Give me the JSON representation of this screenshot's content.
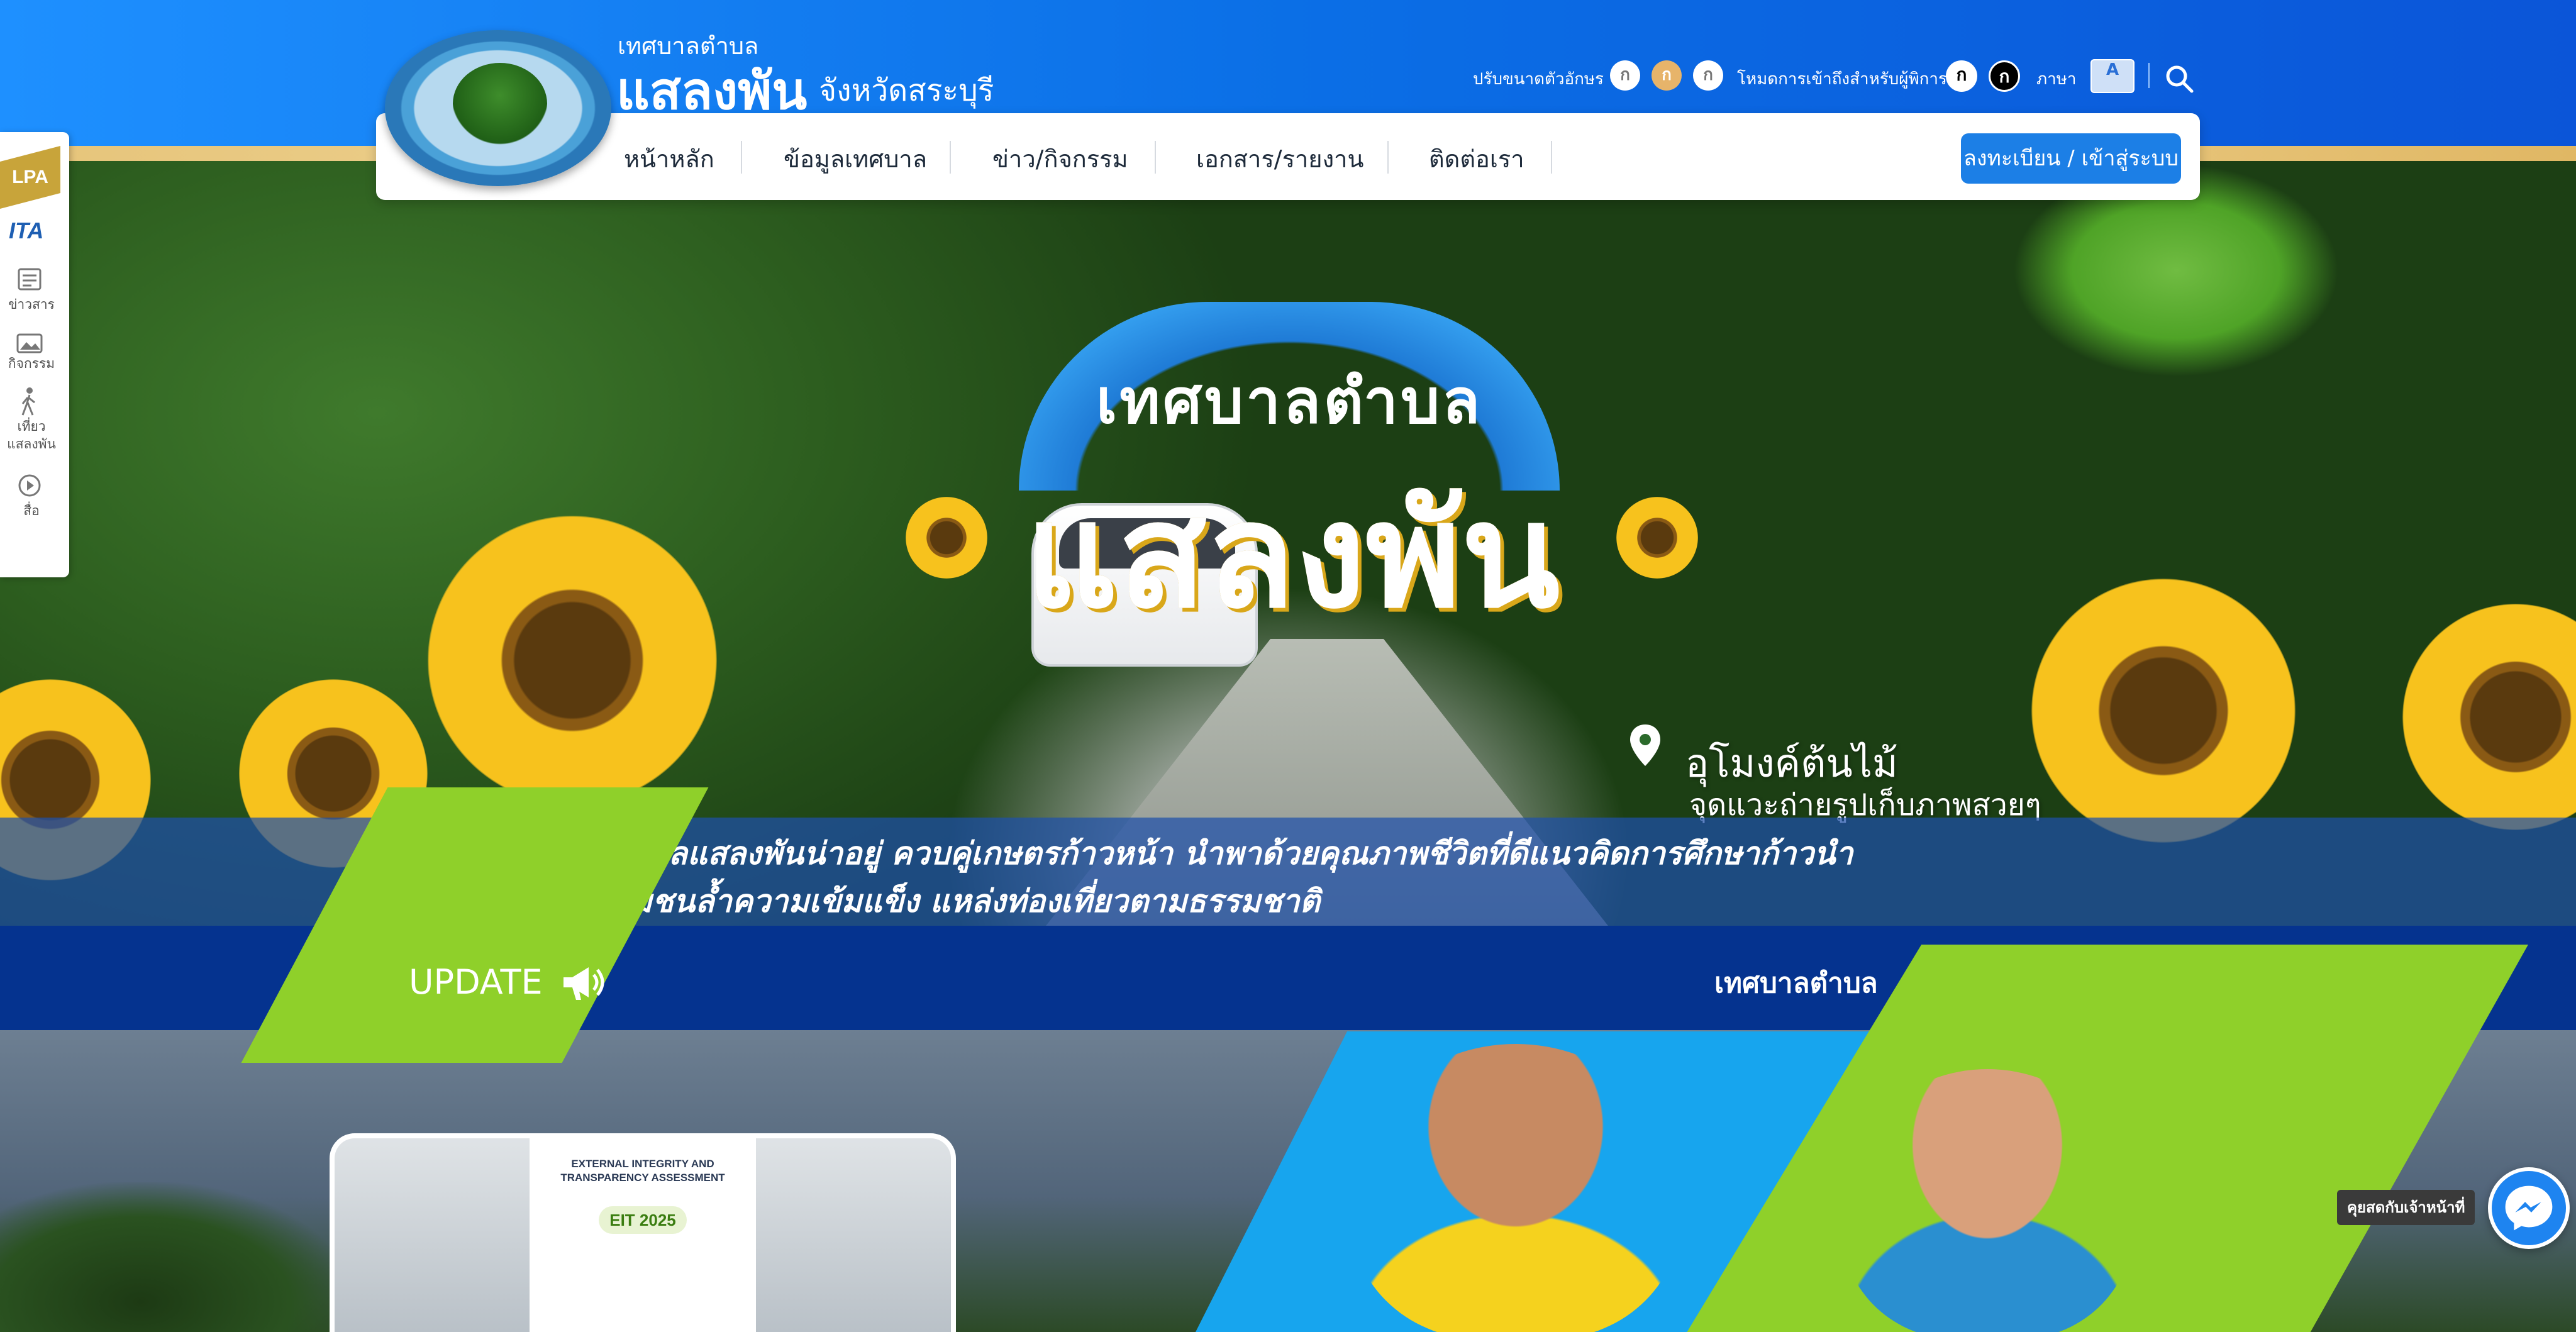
{
  "header": {
    "small_title": "เทศบาลตำบล",
    "name": "แสลงพัน",
    "province": "จังหวัดสระบุรี",
    "logo_alt": "เทศบาลตำบลแสลงพัน อ.วังม่วง จ.สระบุรี"
  },
  "utility": {
    "font_size_label": "ปรับขนาดตัวอักษร",
    "font_buttons": [
      "ก",
      "ก",
      "ก"
    ],
    "accessibility_label": "โหมดการเข้าถึงสำหรับผู้พิการ",
    "contrast_buttons": [
      "ก",
      "ก"
    ],
    "language_label": "ภาษา",
    "language_icon": "translate-icon",
    "search_icon": "search-icon"
  },
  "nav": {
    "items": [
      "หน้าหลัก",
      "ข้อมูลเทศบาล",
      "ข่าว/กิจกรรม",
      "เอกสาร/รายงาน",
      "ติดต่อเรา"
    ],
    "login": "ลงทะเบียน / เข้าสู่ระบบ"
  },
  "sidebar": {
    "lpa": "LPA",
    "ita": "ITA",
    "items": [
      {
        "icon": "newspaper-icon",
        "label": "ข่าวสาร"
      },
      {
        "icon": "image-icon",
        "label": "กิจกรรม"
      },
      {
        "icon": "walking-person-icon",
        "label": "เที่ยว\nแสลงพัน"
      },
      {
        "icon": "play-icon",
        "label": "สื่อ"
      }
    ]
  },
  "hero": {
    "arch_text": "เทศบาลตำบล",
    "big_title": "แสลงพัน",
    "place_title": "อุโมงค์ต้นไม้",
    "place_subtitle": "จุดแวะถ่ายรูปเก็บภาพสวยๆ",
    "slogan_line1": "ตำบลแสลงพันน่าอยู่ ควบคู่เกษตรก้าวหน้า นำพาด้วยคุณภาพชีวิตที่ดีแนวคิดการศึกษาก้าวนำ",
    "slogan_line2": "ชุมชนล้ำความเข้มแข็ง แหล่งท่องเที่ยวตามธรรมชาติ"
  },
  "update": {
    "label": "UPDATE",
    "icon": "megaphone-icon",
    "ticker": "เทศบาลตำบล"
  },
  "card": {
    "poster_title": "EXTERNAL INTEGRITY AND TRANSPARENCY ASSESSMENT",
    "poster_badge": "EIT 2025"
  },
  "chat": {
    "label": "คุยสดกับเจ้าหน้าที่",
    "icon": "messenger-icon"
  },
  "colors": {
    "primary_blue": "#0b6fe6",
    "update_band": "#05338f",
    "accent_green": "#8fd02a",
    "login_button": "#1c7fe6"
  }
}
